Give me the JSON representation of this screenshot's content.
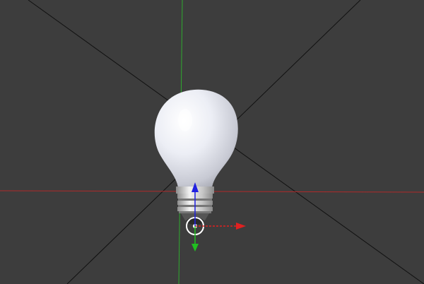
{
  "viewport": {
    "background_color": "#3d3d3d",
    "x_axis_color": "#b02a2a",
    "y_axis_color": "#2faa2f",
    "camera_diagonal_color": "#111111"
  },
  "scene": {
    "object": "light-bulb-mesh",
    "bulb_material_color": "#e6e6ef",
    "base_material_color": "#cfcfcf"
  },
  "gizmo": {
    "type": "translate",
    "axes": [
      {
        "axis": "x",
        "color": "#e02020",
        "icon": "arrow-right"
      },
      {
        "axis": "y",
        "color": "#20c020",
        "icon": "arrow-down"
      },
      {
        "axis": "z",
        "color": "#2020e0",
        "icon": "arrow-up"
      }
    ],
    "center_icon": "3d-cursor"
  }
}
